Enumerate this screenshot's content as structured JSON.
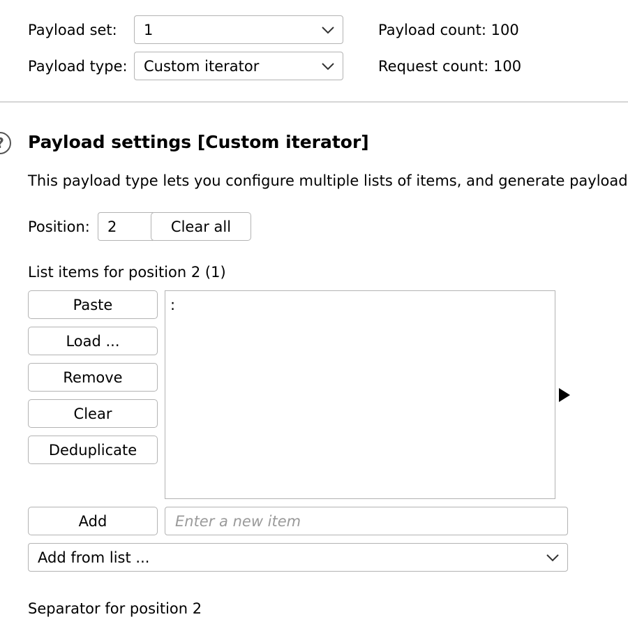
{
  "payload_set": {
    "label": "Payload set:",
    "value": "1"
  },
  "payload_type": {
    "label": "Payload type:",
    "value": "Custom iterator"
  },
  "payload_count": {
    "label": "Payload count:",
    "value": "100"
  },
  "request_count": {
    "label": "Request count:",
    "value": "100"
  },
  "settings": {
    "title": "Payload settings [Custom iterator]",
    "description": "This payload type lets you configure multiple lists of items, and generate payload",
    "help_icon": "question-circle-icon"
  },
  "position": {
    "label": "Position:",
    "value": "2",
    "clear_all_label": "Clear all"
  },
  "list": {
    "heading": "List items for position 2 (1)",
    "items": [
      ":"
    ],
    "buttons": {
      "paste": "Paste",
      "load": "Load ...",
      "remove": "Remove",
      "clear": "Clear",
      "deduplicate": "Deduplicate",
      "add": "Add"
    },
    "new_item_placeholder": "Enter a new item",
    "add_from_list": "Add from list ..."
  },
  "separator": {
    "label": "Separator for position 2"
  },
  "icons": {
    "dropdown": "chevron-down-icon",
    "pager": "play-arrow-icon"
  }
}
